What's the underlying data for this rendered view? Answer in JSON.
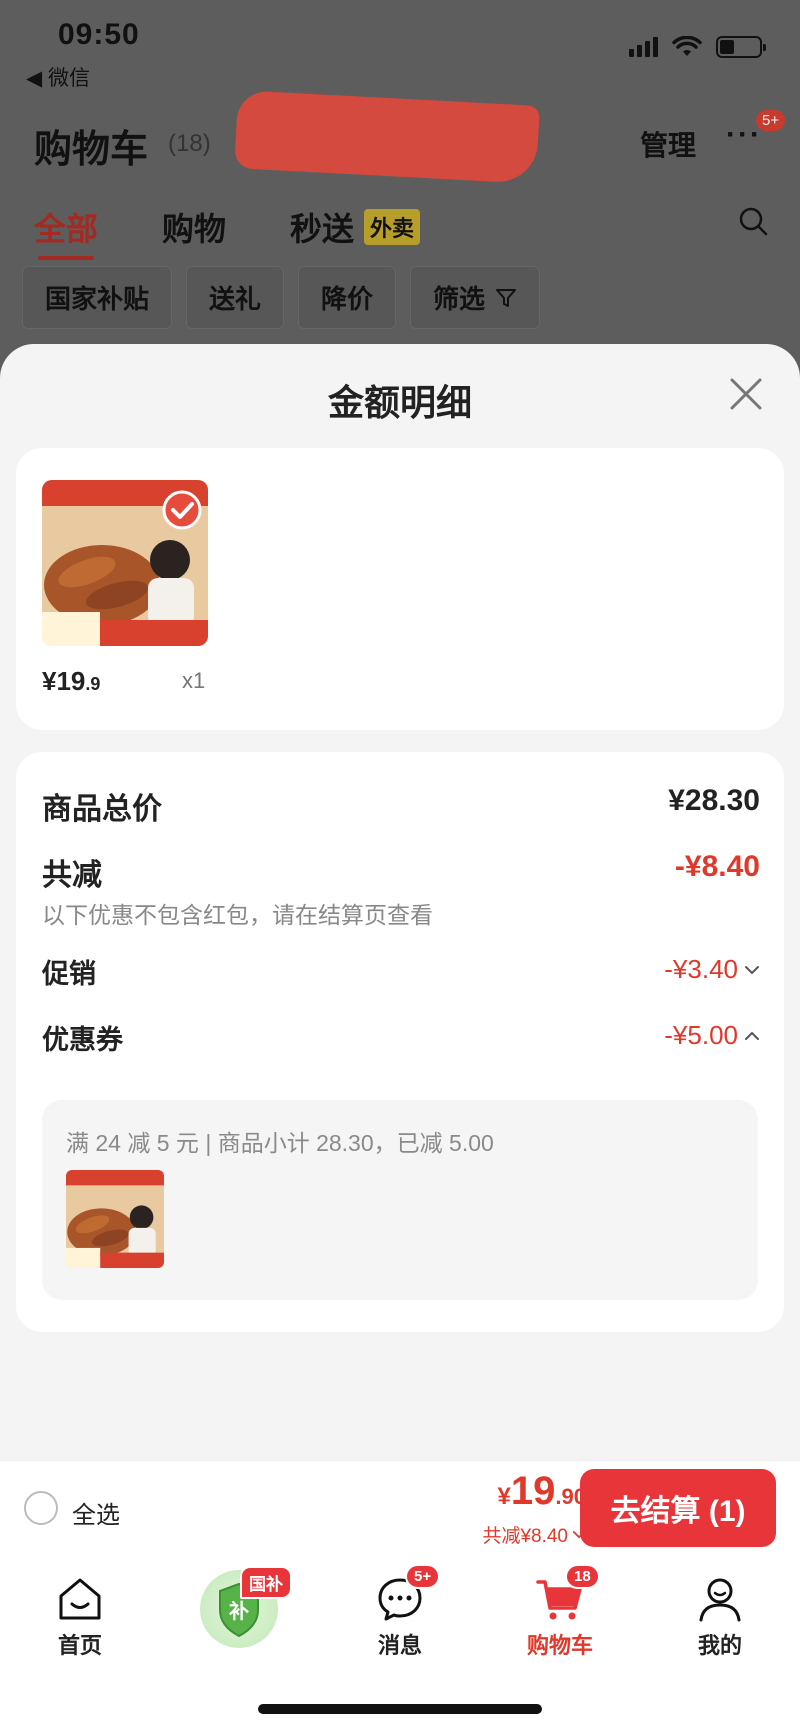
{
  "status_bar": {
    "time": "09:50",
    "back_app": "◀ 微信"
  },
  "header": {
    "title": "购物车",
    "count": "(18)",
    "manage_label": "管理",
    "more_label": "···",
    "more_badge": "5+"
  },
  "tabs": [
    {
      "label": "全部",
      "active": true
    },
    {
      "label": "购物",
      "active": false
    },
    {
      "label": "秒送",
      "active": false,
      "tag": "外卖"
    }
  ],
  "filters": [
    "国家补贴",
    "送礼",
    "降价",
    "筛选"
  ],
  "sheet": {
    "title": "金额明细",
    "product": {
      "price_int": "¥19",
      "price_dec": ".9",
      "qty": "x1"
    },
    "summary": {
      "total_label": "商品总价",
      "total_value": "¥28.30",
      "discount_label": "共减",
      "discount_value": "-¥8.40",
      "discount_note": "以下优惠不包含红包，请在结算页查看",
      "promo_label": "促销",
      "promo_value": "-¥3.40",
      "coupon_label": "优惠券",
      "coupon_value": "-¥5.00",
      "coupon_detail": "满 24 减 5 元 | 商品小计 28.30，已减 5.00"
    }
  },
  "checkout": {
    "select_all": "全选",
    "currency": "¥",
    "amount_int": "19",
    "amount_dec": ".90",
    "discount_text": "共减¥8.40",
    "button_label": "去结算 (1)"
  },
  "tabbar": [
    {
      "label": "首页",
      "icon": "home-icon"
    },
    {
      "label": "国补",
      "icon": "subsidy-shield-icon",
      "badge": "国补"
    },
    {
      "label": "消息",
      "icon": "message-icon",
      "badge": "5+"
    },
    {
      "label": "购物车",
      "icon": "cart-icon",
      "badge": "18",
      "active": true
    },
    {
      "label": "我的",
      "icon": "profile-icon"
    }
  ],
  "colors": {
    "accent_red": "#e8353a",
    "price_red": "#e0382a",
    "sheet_bg": "#f4f4f4",
    "overlay": "#5d5d5d"
  }
}
